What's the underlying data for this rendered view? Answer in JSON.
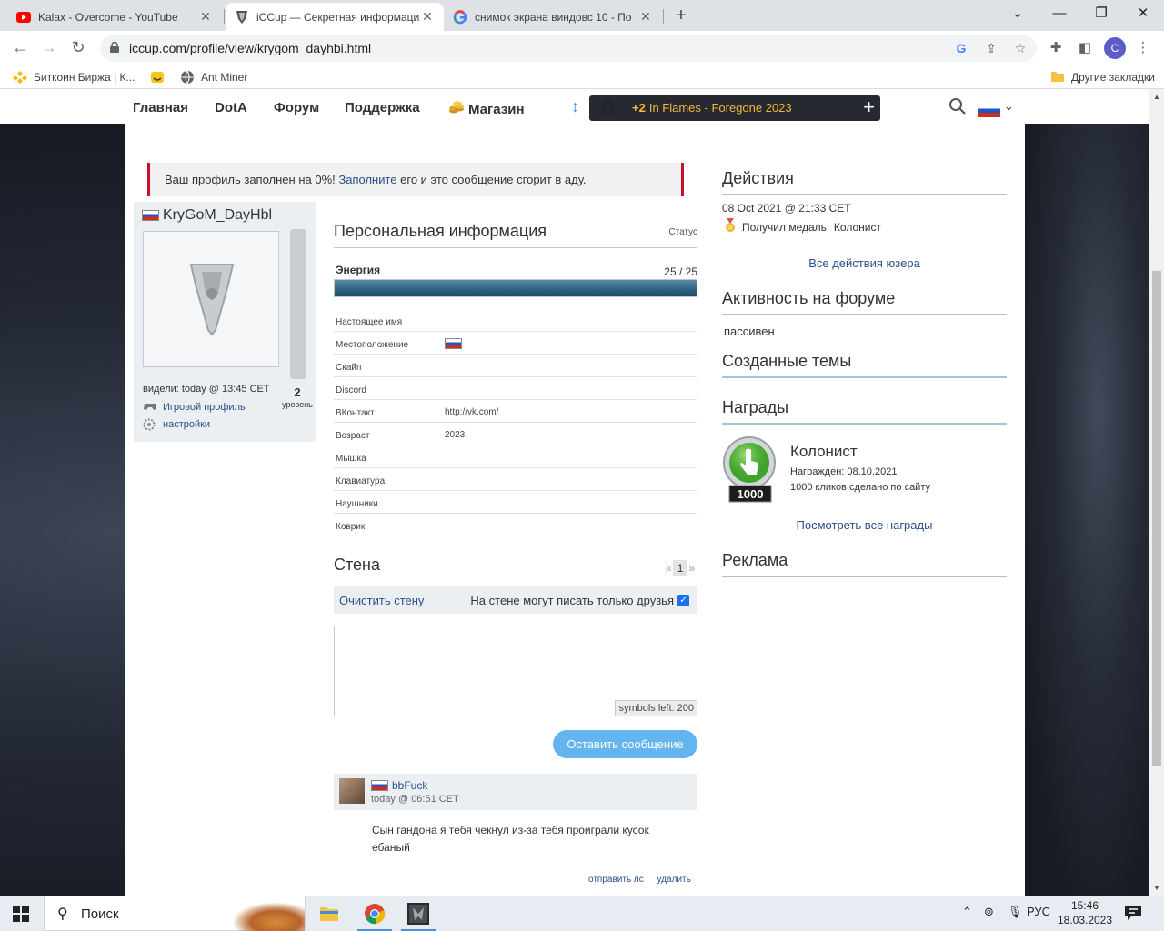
{
  "browser": {
    "tabs": [
      {
        "title": "Kalax - Overcome - YouTube",
        "icon": "youtube-icon"
      },
      {
        "title": "iCCup — Секретная информация",
        "icon": "iccup-icon"
      },
      {
        "title": "снимок экрана виндовс 10 - По",
        "icon": "google-icon"
      }
    ],
    "new_tab": "+",
    "url": "iccup.com/profile/view/krygom_dayhbi.html",
    "account_initial": "C",
    "bookmarks": [
      {
        "label": "Биткоин Биржа | К...",
        "icon": "binance-icon"
      },
      {
        "label": "",
        "icon": "smiley-icon"
      },
      {
        "label": "Ant Miner",
        "icon": "globe-icon"
      }
    ],
    "other_bookmarks": "Другие закладки"
  },
  "site_nav": {
    "items": [
      "Главная",
      "DotA",
      "Форум",
      "Поддержка",
      "Магазин"
    ],
    "stream": {
      "count": "+2",
      "title": "In Flames - Foregone 2023",
      "plus": "+"
    }
  },
  "alert": {
    "before": "Ваш профиль заполнен на 0%! ",
    "link": "Заполните",
    "after": " его и это сообщение сгорит в аду."
  },
  "profile": {
    "username": "KryGoM_DayHbl",
    "seen": "видели: today @ 13:45 CET",
    "level": "2",
    "level_label": "уровень",
    "game_profile": "Игровой профиль",
    "settings": "настройки"
  },
  "personal": {
    "title": "Персональная информация",
    "status_label": "Статус",
    "energy_label": "Энергия",
    "energy_value": "25 / 25",
    "energy_fraction": 1.0,
    "rows": [
      {
        "key": "Настоящее имя",
        "value": ""
      },
      {
        "key": "Местоположение",
        "value": ""
      },
      {
        "key": "Скайп",
        "value": ""
      },
      {
        "key": "Discord",
        "value": ""
      },
      {
        "key": "ВКонтакт",
        "value": "http://vk.com/"
      },
      {
        "key": "Возраст",
        "value": "2023"
      },
      {
        "key": "Мышка",
        "value": ""
      },
      {
        "key": "Клавиатура",
        "value": ""
      },
      {
        "key": "Наушники",
        "value": ""
      },
      {
        "key": "Коврик",
        "value": ""
      }
    ]
  },
  "wall": {
    "title": "Стена",
    "pager_prev": "«",
    "page": "1",
    "pager_next": "»",
    "clear": "Очистить стену",
    "friends_only": "На стене могут писать только друзья",
    "friends_only_checked": true,
    "symbols_left": "symbols left: 200",
    "post_button": "Оставить сообщение",
    "comment": {
      "author": "bbFuck",
      "time": "today @ 06:51 CET",
      "text": "Сын гандона я тебя чекнул из-за тебя проиграли кусок ебаный",
      "reply": "отправить лс",
      "delete": "удалить"
    }
  },
  "right": {
    "actions_title": "Действия",
    "action_date": "08 Oct 2021 @ 21:33 CET",
    "action_text": "Получил медаль",
    "action_medal": "Колонист",
    "all_actions": "Все действия юзера",
    "forum_title": "Активность на форуме",
    "forum_status": "пассивен",
    "topics_title": "Созданные темы",
    "awards_title": "Награды",
    "award_name": "Колонист",
    "award_badge": "1000",
    "award_date": "Награжден: 08.10.2021",
    "award_desc": "1000 кликов сделано по сайту",
    "all_awards": "Посмотреть все награды",
    "ads_title": "Реклама"
  },
  "taskbar": {
    "search_placeholder": "Поиск",
    "lang": "РУС",
    "time": "15:46",
    "date": "18.03.2023"
  },
  "colors": {
    "accent_link": "#2a4f8a",
    "alert_border": "#c8102e",
    "stream_text": "#f5b83d",
    "post_button": "#64b5ef"
  }
}
